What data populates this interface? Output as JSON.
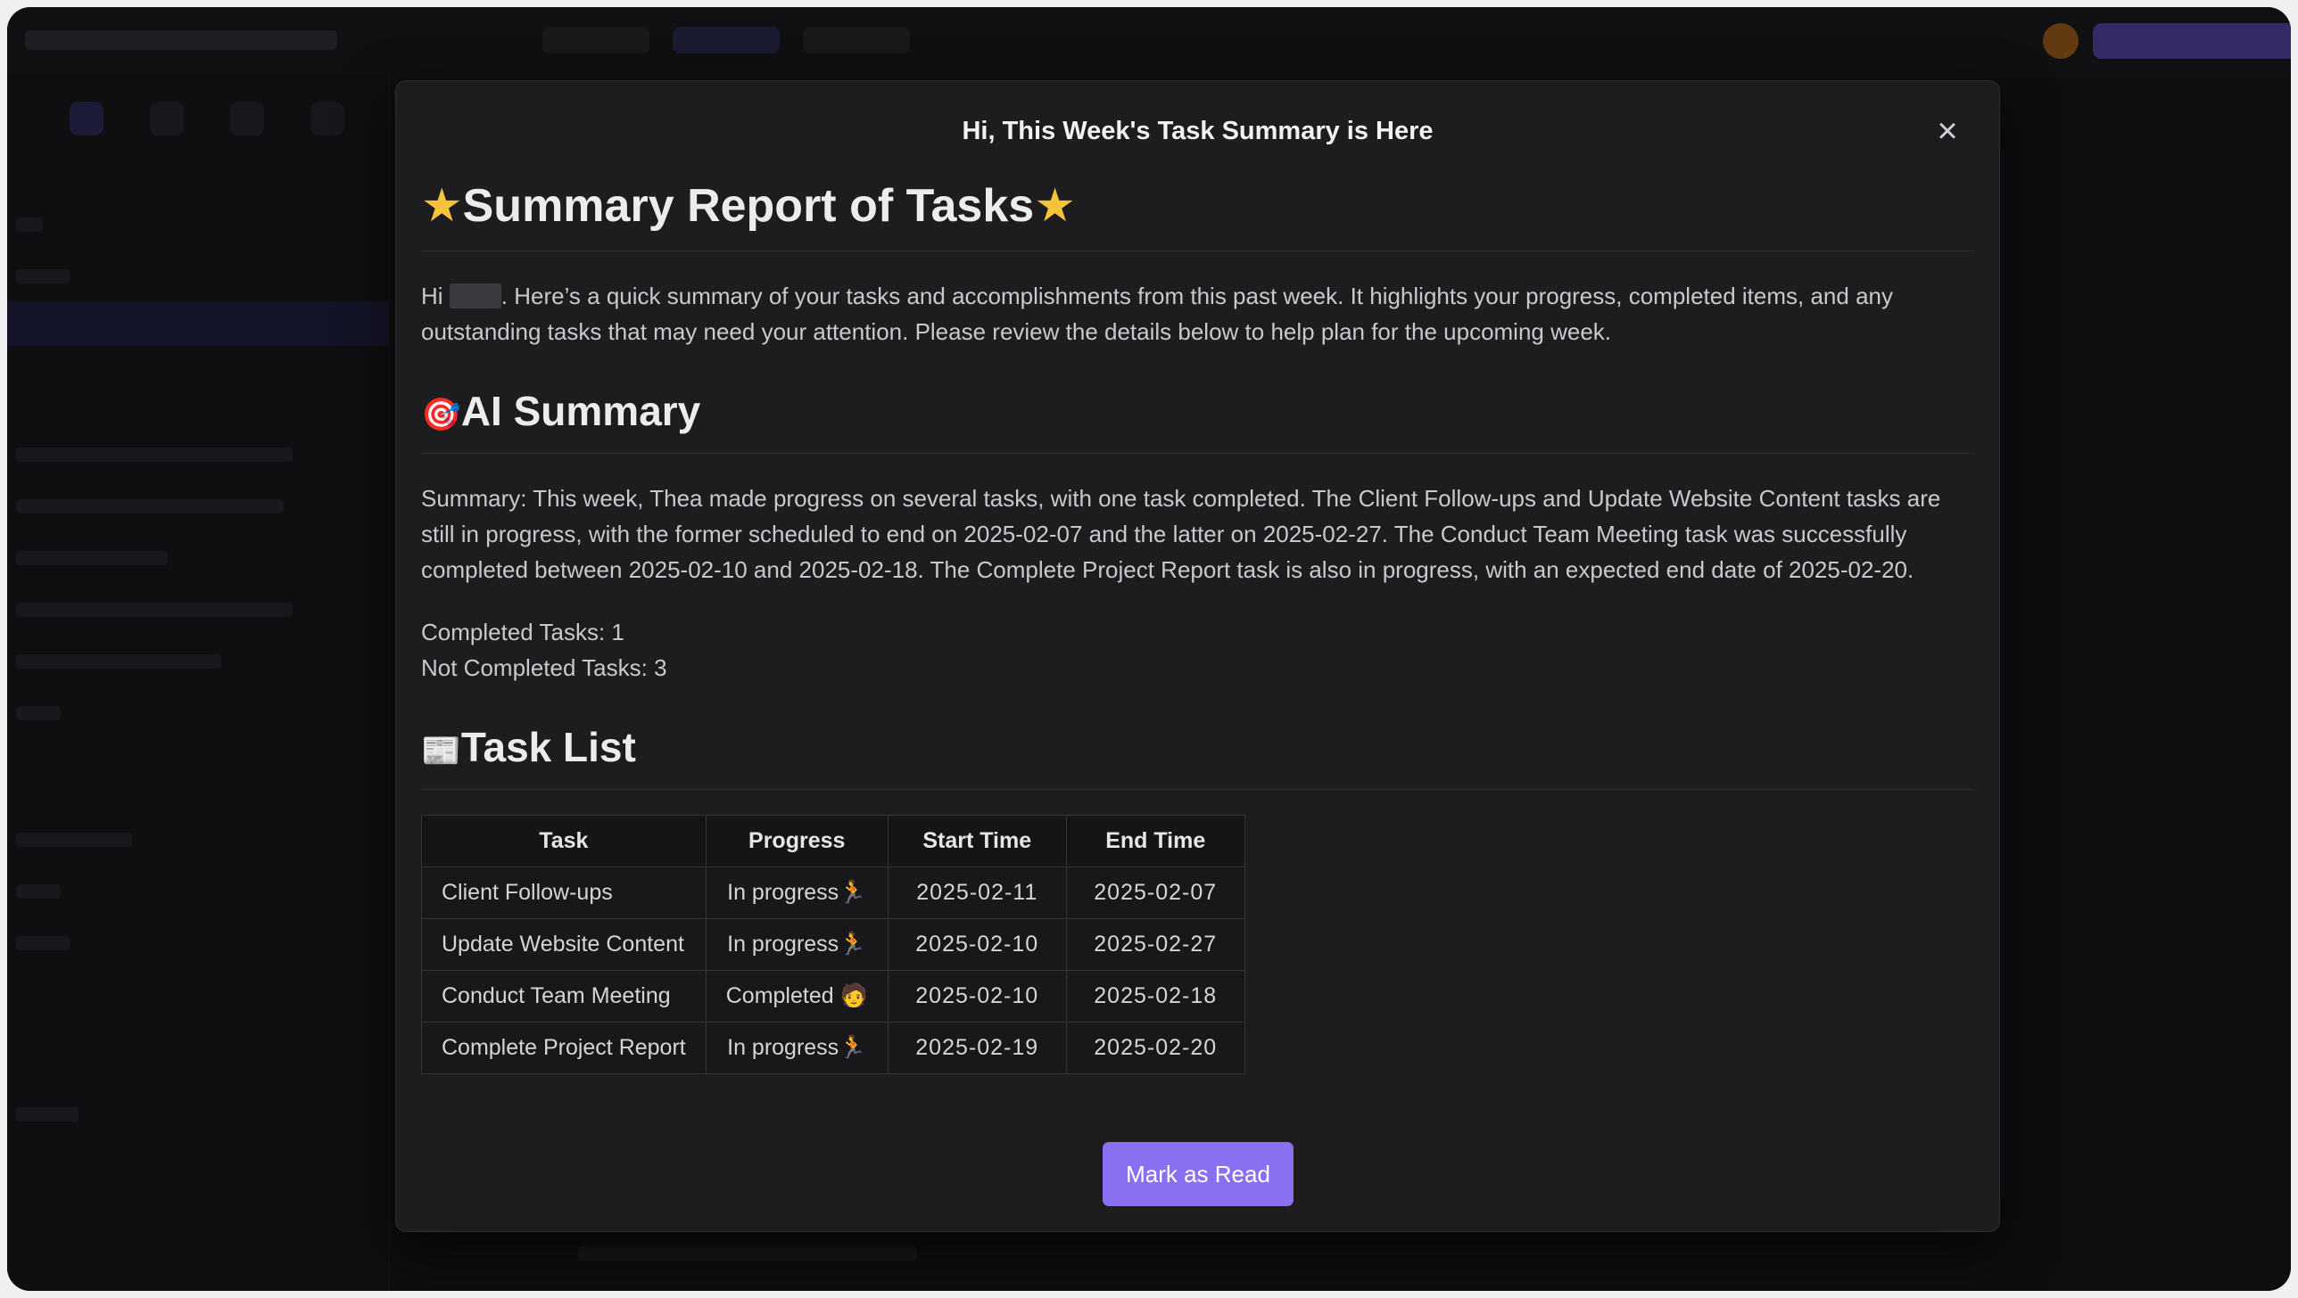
{
  "modal": {
    "title": "Hi, This Week's Task Summary is Here",
    "close_symbol": "×",
    "report_title": "Summary Report of Tasks",
    "report_title_icon": "star-icon",
    "intro_greeting": "Hi",
    "intro_text": ". Here’s a quick summary of your tasks and accomplishments from this past week. It highlights your progress, completed items, and any outstanding tasks that may need your attention. Please review the details below to help plan for the upcoming week.",
    "ai_summary_heading": "AI Summary",
    "ai_summary_icon": "target-icon",
    "summary_text": "Summary: This week, Thea made progress on several tasks, with one task completed. The Client Follow-ups and Update Website Content tasks are still in progress, with the former scheduled to end on 2025-02-07 and the latter on 2025-02-27. The Conduct Team Meeting task was successfully completed between 2025-02-10 and 2025-02-18. The Complete Project Report task is also in progress, with an expected end date of 2025-02-20.",
    "completed_count": "Completed Tasks: 1",
    "not_completed_count": "Not Completed Tasks: 3",
    "task_list_heading": "Task List",
    "task_list_icon": "newspaper-icon",
    "table": {
      "headers": [
        "Task",
        "Progress",
        "Start Time",
        "End Time"
      ],
      "rows": [
        {
          "task": "Client Follow-ups",
          "progress": "In progress",
          "progress_icon": "runner-icon",
          "start": "2025-02-11",
          "end": "2025-02-07"
        },
        {
          "task": "Update Website Content",
          "progress": "In progress",
          "progress_icon": "runner-icon",
          "start": "2025-02-10",
          "end": "2025-02-27"
        },
        {
          "task": "Conduct Team Meeting",
          "progress": "Completed",
          "progress_icon": "person-icon",
          "start": "2025-02-10",
          "end": "2025-02-18"
        },
        {
          "task": "Complete Project Report",
          "progress": "In progress",
          "progress_icon": "runner-icon",
          "start": "2025-02-19",
          "end": "2025-02-20"
        }
      ]
    },
    "mark_read_label": "Mark as Read",
    "accent_color": "#8a6ff0"
  }
}
